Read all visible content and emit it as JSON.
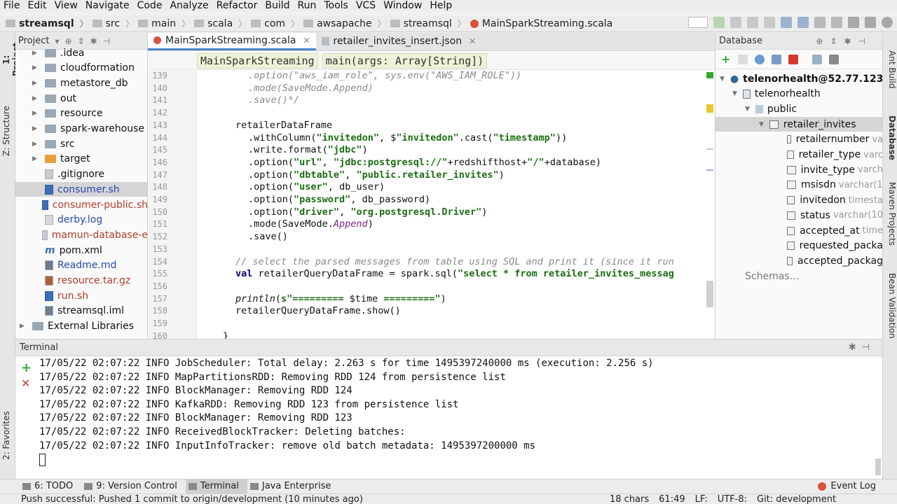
{
  "menu": [
    "File",
    "Edit",
    "View",
    "Navigate",
    "Code",
    "Analyze",
    "Refactor",
    "Build",
    "Run",
    "Tools",
    "VCS",
    "Window",
    "Help"
  ],
  "breadcrumbs": [
    "streamsql",
    "src",
    "main",
    "scala",
    "com",
    "awsapache",
    "streamsql",
    "MainSparkStreaming.scala"
  ],
  "left_stripe": {
    "project": "1: Project",
    "structure": "Z: Structure",
    "favorites": "2: Favorites"
  },
  "right_stripe": {
    "ant": "Ant Build",
    "database": "Database",
    "maven": "Maven Projects",
    "bean": "Bean Validation"
  },
  "project_panel": {
    "title": "Project",
    "items": [
      {
        "label": ".idea",
        "kind": "folder"
      },
      {
        "label": "cloudformation",
        "kind": "folder"
      },
      {
        "label": "metastore_db",
        "kind": "folder"
      },
      {
        "label": "out",
        "kind": "folder"
      },
      {
        "label": "resource",
        "kind": "folder"
      },
      {
        "label": "spark-warehouse",
        "kind": "folder"
      },
      {
        "label": "src",
        "kind": "folder"
      },
      {
        "label": "target",
        "kind": "folder-orange"
      },
      {
        "label": ".gitignore",
        "kind": "file"
      },
      {
        "label": "consumer.sh",
        "kind": "sh"
      },
      {
        "label": "consumer-public.sh",
        "kind": "sh"
      },
      {
        "label": "derby.log",
        "kind": "log"
      },
      {
        "label": "mamun-database-e",
        "kind": "file"
      },
      {
        "label": "pom.xml",
        "kind": "m"
      },
      {
        "label": "Readme.md",
        "kind": "md"
      },
      {
        "label": "resource.tar.gz",
        "kind": "gz"
      },
      {
        "label": "run.sh",
        "kind": "sh"
      },
      {
        "label": "streamsql.iml",
        "kind": "iml"
      },
      {
        "label": "External Libraries",
        "kind": "lib"
      }
    ]
  },
  "editor": {
    "tabs": [
      {
        "label": "MainSparkStreaming.scala",
        "active": true
      },
      {
        "label": "retailer_invites_insert.json",
        "active": false
      }
    ],
    "code_breadcrumbs": [
      "MainSparkStreaming",
      "main(args: Array[String])"
    ],
    "line_numbers": [
      "139",
      "140",
      "141",
      "142",
      "143",
      "144",
      "145",
      "146",
      "147",
      "148",
      "149",
      "150",
      "151",
      "152",
      "153",
      "154",
      "155",
      "156",
      "157",
      "158",
      "159",
      "160"
    ],
    "lines": [
      {
        "indent": "   ",
        "parts": [
          {
            "t": ".option(\"aws_iam_role\", sys.env(\"AWS_IAM_ROLE\"))",
            "c": "cm"
          }
        ]
      },
      {
        "indent": "   ",
        "parts": [
          {
            "t": ".mode(SaveMode.Append)",
            "c": "cm"
          }
        ]
      },
      {
        "indent": "   ",
        "parts": [
          {
            "t": ".save()*/",
            "c": "cm"
          }
        ]
      },
      {
        "indent": "",
        "parts": []
      },
      {
        "indent": " ",
        "parts": [
          {
            "t": "retailerDataFrame",
            "c": ""
          }
        ]
      },
      {
        "indent": "   ",
        "parts": [
          {
            "t": ".withColumn(",
            "c": ""
          },
          {
            "t": "\"invitedon\"",
            "c": "st"
          },
          {
            "t": ", $",
            "c": ""
          },
          {
            "t": "\"invitedon\"",
            "c": "st"
          },
          {
            "t": ".cast(",
            "c": ""
          },
          {
            "t": "\"timestamp\"",
            "c": "st"
          },
          {
            "t": "))",
            "c": ""
          }
        ]
      },
      {
        "indent": "   ",
        "parts": [
          {
            "t": ".write.format(",
            "c": ""
          },
          {
            "t": "\"jdbc\"",
            "c": "st"
          },
          {
            "t": ")",
            "c": ""
          }
        ]
      },
      {
        "indent": "   ",
        "parts": [
          {
            "t": ".option(",
            "c": ""
          },
          {
            "t": "\"url\"",
            "c": "st"
          },
          {
            "t": ", ",
            "c": ""
          },
          {
            "t": "\"jdbc:postgresql://\"",
            "c": "st"
          },
          {
            "t": "+redshifthost+",
            "c": ""
          },
          {
            "t": "\"/\"",
            "c": "st"
          },
          {
            "t": "+database)",
            "c": ""
          }
        ]
      },
      {
        "indent": "   ",
        "parts": [
          {
            "t": ".option(",
            "c": ""
          },
          {
            "t": "\"dbtable\"",
            "c": "st"
          },
          {
            "t": ", ",
            "c": ""
          },
          {
            "t": "\"public.retailer_invites\"",
            "c": "st"
          },
          {
            "t": ")",
            "c": ""
          }
        ]
      },
      {
        "indent": "   ",
        "parts": [
          {
            "t": ".option(",
            "c": ""
          },
          {
            "t": "\"user\"",
            "c": "st"
          },
          {
            "t": ", db_user)",
            "c": ""
          }
        ]
      },
      {
        "indent": "   ",
        "parts": [
          {
            "t": ".option(",
            "c": ""
          },
          {
            "t": "\"password\"",
            "c": "st"
          },
          {
            "t": ", db_password)",
            "c": ""
          }
        ]
      },
      {
        "indent": "   ",
        "parts": [
          {
            "t": ".option(",
            "c": ""
          },
          {
            "t": "\"driver\"",
            "c": "st"
          },
          {
            "t": ", ",
            "c": ""
          },
          {
            "t": "\"org.postgresql.Driver\"",
            "c": "st"
          },
          {
            "t": ")",
            "c": ""
          }
        ]
      },
      {
        "indent": "   ",
        "parts": [
          {
            "t": ".mode(SaveMode.",
            "c": ""
          },
          {
            "t": "Append",
            "c": "it"
          },
          {
            "t": ")",
            "c": ""
          }
        ]
      },
      {
        "indent": "   ",
        "parts": [
          {
            "t": ".save()",
            "c": ""
          }
        ]
      },
      {
        "indent": "",
        "parts": []
      },
      {
        "indent": " ",
        "parts": [
          {
            "t": "// select the parsed messages from table using SQL and print it (since it run",
            "c": "cm"
          }
        ]
      },
      {
        "indent": " ",
        "parts": [
          {
            "t": "val",
            "c": "kw"
          },
          {
            "t": " retailerQueryDataFrame = spark.sql(",
            "c": ""
          },
          {
            "t": "\"select * from retailer_invites_messag",
            "c": "st"
          }
        ]
      },
      {
        "indent": "",
        "parts": []
      },
      {
        "indent": " ",
        "parts": [
          {
            "t": "println",
            "c": "ib"
          },
          {
            "t": "(",
            "c": ""
          },
          {
            "t": "s\"========= ",
            "c": "st"
          },
          {
            "t": "$time",
            "c": ""
          },
          {
            "t": " =========\"",
            "c": "st"
          },
          {
            "t": ")",
            "c": ""
          }
        ]
      },
      {
        "indent": " ",
        "parts": [
          {
            "t": "retailerQueryDataFrame.show()",
            "c": ""
          }
        ]
      },
      {
        "indent": "",
        "parts": []
      },
      {
        "indent": "}",
        "parts": []
      }
    ]
  },
  "database_panel": {
    "title": "Database",
    "connection": "telenorhealth@52.77.123.2",
    "database": "telenorhealth",
    "schema": "public",
    "table": "retailer_invites",
    "columns": [
      {
        "name": "retailernumber",
        "type": "va"
      },
      {
        "name": "retailer_type",
        "type": "varc"
      },
      {
        "name": "invite_type",
        "type": "varch"
      },
      {
        "name": "msisdn",
        "type": "varchar(1"
      },
      {
        "name": "invitedon",
        "type": "timesta"
      },
      {
        "name": "status",
        "type": "varchar(10"
      },
      {
        "name": "accepted_at",
        "type": "time"
      },
      {
        "name": "requested_packa",
        "type": ""
      },
      {
        "name": "accepted_packag",
        "type": ""
      }
    ],
    "schemas_label": "Schemas..."
  },
  "terminal": {
    "title": "Terminal",
    "lines": [
      "17/05/22 02:07:22 INFO JobScheduler: Total delay: 2.263 s for time 1495397240000 ms (execution: 2.256 s)",
      "17/05/22 02:07:22 INFO MapPartitionsRDD: Removing RDD 124 from persistence list",
      "17/05/22 02:07:22 INFO BlockManager: Removing RDD 124",
      "17/05/22 02:07:22 INFO KafkaRDD: Removing RDD 123 from persistence list",
      "17/05/22 02:07:22 INFO BlockManager: Removing RDD 123",
      "17/05/22 02:07:22 INFO ReceivedBlockTracker: Deleting batches:",
      "17/05/22 02:07:22 INFO InputInfoTracker: remove old batch metadata: 1495397200000 ms"
    ]
  },
  "tool_tabs": [
    {
      "label": "6: TODO",
      "active": false
    },
    {
      "label": "9: Version Control",
      "active": false
    },
    {
      "label": "Terminal",
      "active": true
    },
    {
      "label": "Java Enterprise",
      "active": false
    }
  ],
  "event_log": "Event Log",
  "status": {
    "message": "Push successful: Pushed 1 commit to origin/development (10 minutes ago)",
    "chars": "18 chars",
    "position": "61:49",
    "line_sep": "LF:",
    "encoding": "UTF-8:",
    "git": "Git: development"
  },
  "colors": {
    "accent": "#4a86c8",
    "string": "#1b6d13",
    "keyword": "#00007a",
    "comment": "#8a8a8a",
    "error": "#d7513b"
  }
}
